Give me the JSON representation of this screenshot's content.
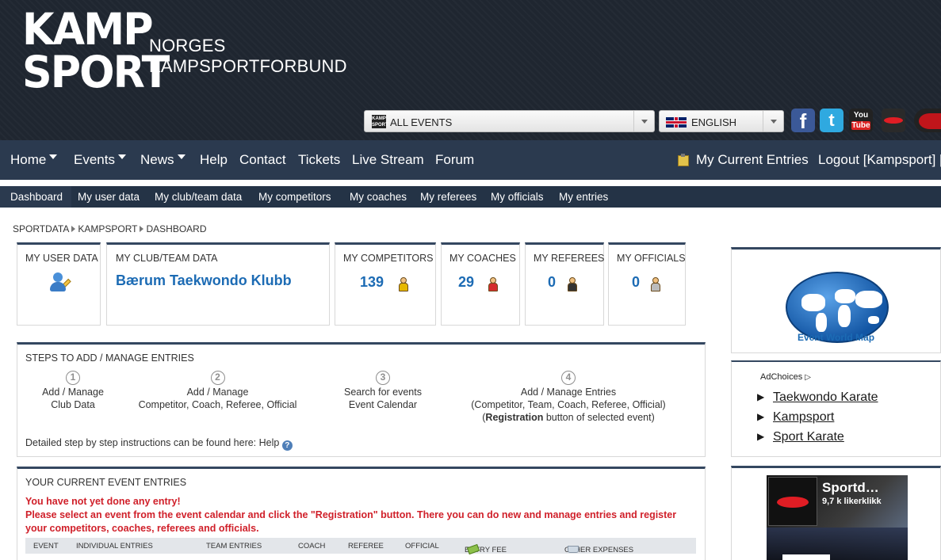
{
  "header": {
    "logo_line1": "KAMP",
    "logo_line2": "SPORT",
    "org_line1": "NORGES",
    "org_line2": "KAMPSPORTFORBUND",
    "events_select": "ALL EVENTS",
    "events_logo_top": "KAMP",
    "events_logo_bottom": "SPORT",
    "language_select": "ENGLISH",
    "social": {
      "facebook": "f",
      "twitter": "t",
      "youtube_top": "You",
      "youtube_bottom": "Tube"
    }
  },
  "mainnav": {
    "home": "Home",
    "events": "Events",
    "news": "News",
    "help": "Help",
    "contact": "Contact",
    "tickets": "Tickets",
    "live": "Live Stream",
    "forum": "Forum",
    "current_entries": "My Current Entries",
    "logout": "Logout [Kampsport] ["
  },
  "subnav": {
    "items": [
      "Dashboard",
      "My user data",
      "My club/team data",
      "My competitors",
      "My coaches",
      "My referees",
      "My officials",
      "My entries"
    ]
  },
  "breadcrumb": {
    "parts": [
      "SPORTDATA",
      "KAMPSPORT",
      "DASHBOARD"
    ]
  },
  "cards": {
    "user": "MY USER DATA",
    "club": "MY CLUB/TEAM DATA",
    "club_name": "Bærum Taekwondo Klubb",
    "competitors": "MY COMPETITORS",
    "competitors_count": "139",
    "coaches": "MY COACHES",
    "coaches_count": "29",
    "referees": "MY REFEREES",
    "referees_count": "0",
    "officials": "MY OFFICIALS",
    "officials_count": "0"
  },
  "steps": {
    "title": "STEPS TO ADD / MANAGE ENTRIES",
    "items": [
      {
        "num": "1",
        "line1": "Add / Manage",
        "line2": "Club Data"
      },
      {
        "num": "2",
        "line1": "Add / Manage",
        "line2": "Competitor, Coach, Referee, Official"
      },
      {
        "num": "3",
        "line1": "Search for events",
        "line2": "Event Calendar"
      },
      {
        "num": "4",
        "line1": "Add / Manage Entries",
        "line2": "(Competitor, Team, Coach, Referee, Official)",
        "line3_bold": "Registration",
        "line3_rest": " button of selected event)",
        "line3_open": "("
      }
    ],
    "help_text": "Detailed step by step instructions can be found here: Help",
    "help_icon": "?"
  },
  "entries": {
    "title": "YOUR CURRENT EVENT ENTRIES",
    "warn1": "You have not yet done any entry!",
    "warn2": "Please select an event from the event calendar and click the \"Registration\" button. There you can do new and manage entries and register",
    "warn3": "your competitors, coaches, referees and officials.",
    "columns": [
      "EVENT",
      "INDIVIDUAL ENTRIES",
      "TEAM ENTRIES",
      "COACH",
      "REFEREE",
      "OFFICIAL",
      "ENTRY FEE",
      "OTHER EXPENSES"
    ]
  },
  "sidebar": {
    "map_label": "Event World Map",
    "adchoices": "AdChoices",
    "ad_links": [
      "Taekwondo Karate",
      "Kampsport",
      "Sport Karate"
    ],
    "fb_title": "Sportd…",
    "fb_likes": "9,7 k likerklikk"
  },
  "colors": {
    "header_bg": "#1f2630",
    "nav_bg": "#2b3a4f",
    "accent_blue": "#1c6bb4",
    "warning_red": "#d0202a"
  }
}
